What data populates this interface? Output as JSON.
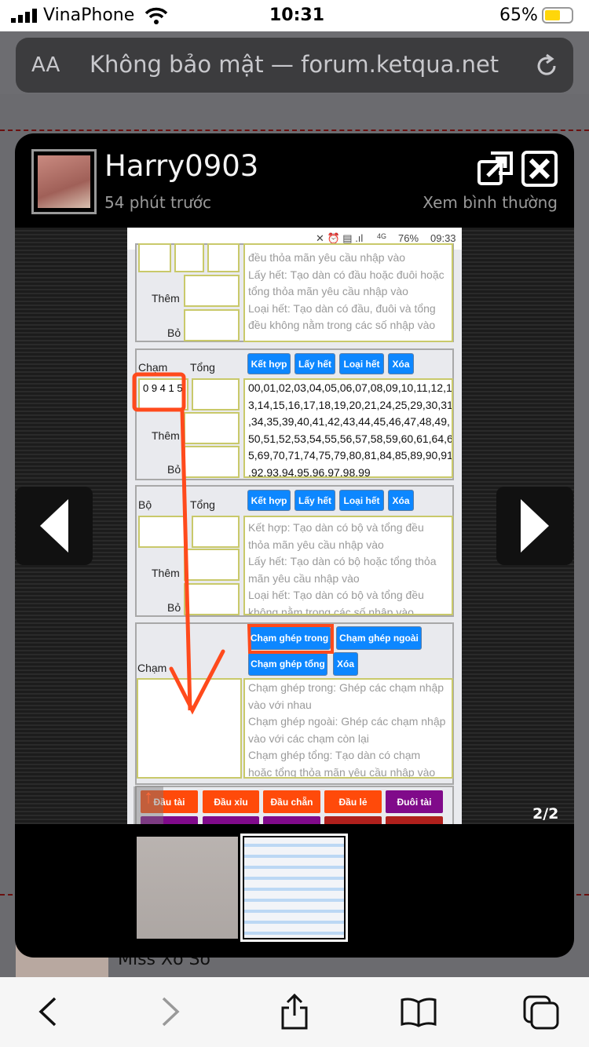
{
  "status_bar": {
    "carrier": "VinaPhone",
    "time": "10:31",
    "battery": "65%"
  },
  "url_bar": {
    "text_size": "AA",
    "url": "Không bảo mật — forum.ketqua.net"
  },
  "lightbox": {
    "username": "Harry0903",
    "time_ago": "54 phút trước",
    "normal_view_link": "Xem bình thường",
    "counter": "2/2",
    "thumbnail_count": 2,
    "selected_thumbnail": 2
  },
  "inner_screenshot": {
    "status": {
      "battery": "76%",
      "time": "09:33",
      "network": "4G"
    },
    "panel1": {
      "them": "Thêm",
      "bo": "Bỏ",
      "help": [
        "đều thỏa mãn yêu cầu nhập vào",
        "Lấy hết: Tạo dàn có đầu hoặc đuôi hoặc",
        "tổng thỏa mãn yêu cầu nhập vào",
        "Loại hết: Tạo dàn có đầu, đuôi và tổng",
        "đều không nằm trong các số nhập vào"
      ]
    },
    "panel2": {
      "cham": "Chạm",
      "tong": "Tổng",
      "them": "Thêm",
      "bo": "Bỏ",
      "cham_value": "0 9 4 1 5",
      "buttons": [
        "Kết hợp",
        "Lấy hết",
        "Loại hết",
        "Xóa"
      ],
      "result": [
        "00,01,02,03,04,05,06,07,08,09,10,11,12,1",
        "3,14,15,16,17,18,19,20,21,24,25,29,30,31",
        ",34,35,39,40,41,42,43,44,45,46,47,48,49,",
        "50,51,52,53,54,55,56,57,58,59,60,61,64,6",
        "5,69,70,71,74,75,79,80,81,84,85,89,90,91",
        ",92,93,94,95,96,97,98,99"
      ]
    },
    "panel3": {
      "bo_label": "Bộ",
      "tong": "Tổng",
      "them": "Thêm",
      "bo": "Bỏ",
      "buttons": [
        "Kết hợp",
        "Lấy hết",
        "Loại hết",
        "Xóa"
      ],
      "help": [
        "Kết hợp: Tạo dàn có bộ và tổng đều",
        "thỏa mãn yêu cầu nhập vào",
        "Lấy hết: Tạo dàn có bộ hoặc tổng thỏa",
        "mãn yêu cầu nhập vào",
        "Loại hết: Tạo dàn có bộ và tổng đều",
        "không nằm trong các số nhập vào"
      ]
    },
    "panel4": {
      "cham": "Chạm",
      "buttons": [
        "Chạm ghép trong",
        "Chạm ghép ngoài",
        "Chạm ghép tổng",
        "Xóa"
      ],
      "help": [
        "Chạm ghép trong: Ghép các chạm nhập",
        "vào với nhau",
        "Chạm ghép ngoài: Ghép các chạm nhập",
        "vào với các chạm còn lại",
        "Chạm ghép tổng: Tạo dàn có chạm",
        "hoặc tổng thỏa mãn yêu cầu nhập vào"
      ]
    },
    "panel5": {
      "buttons": [
        "Đầu tài",
        "Đầu xỉu",
        "Đầu chẵn",
        "Đầu lẻ",
        "Đuôi tài"
      ]
    }
  },
  "background": {
    "forum_text": "Miss Xổ Số"
  },
  "colors": {
    "blue_button": "#0d87ff",
    "orange_button": "#ff4a0a",
    "purple_button": "#800a8a",
    "annotation": "#ff4a1c",
    "battery": "#ffd60a"
  }
}
